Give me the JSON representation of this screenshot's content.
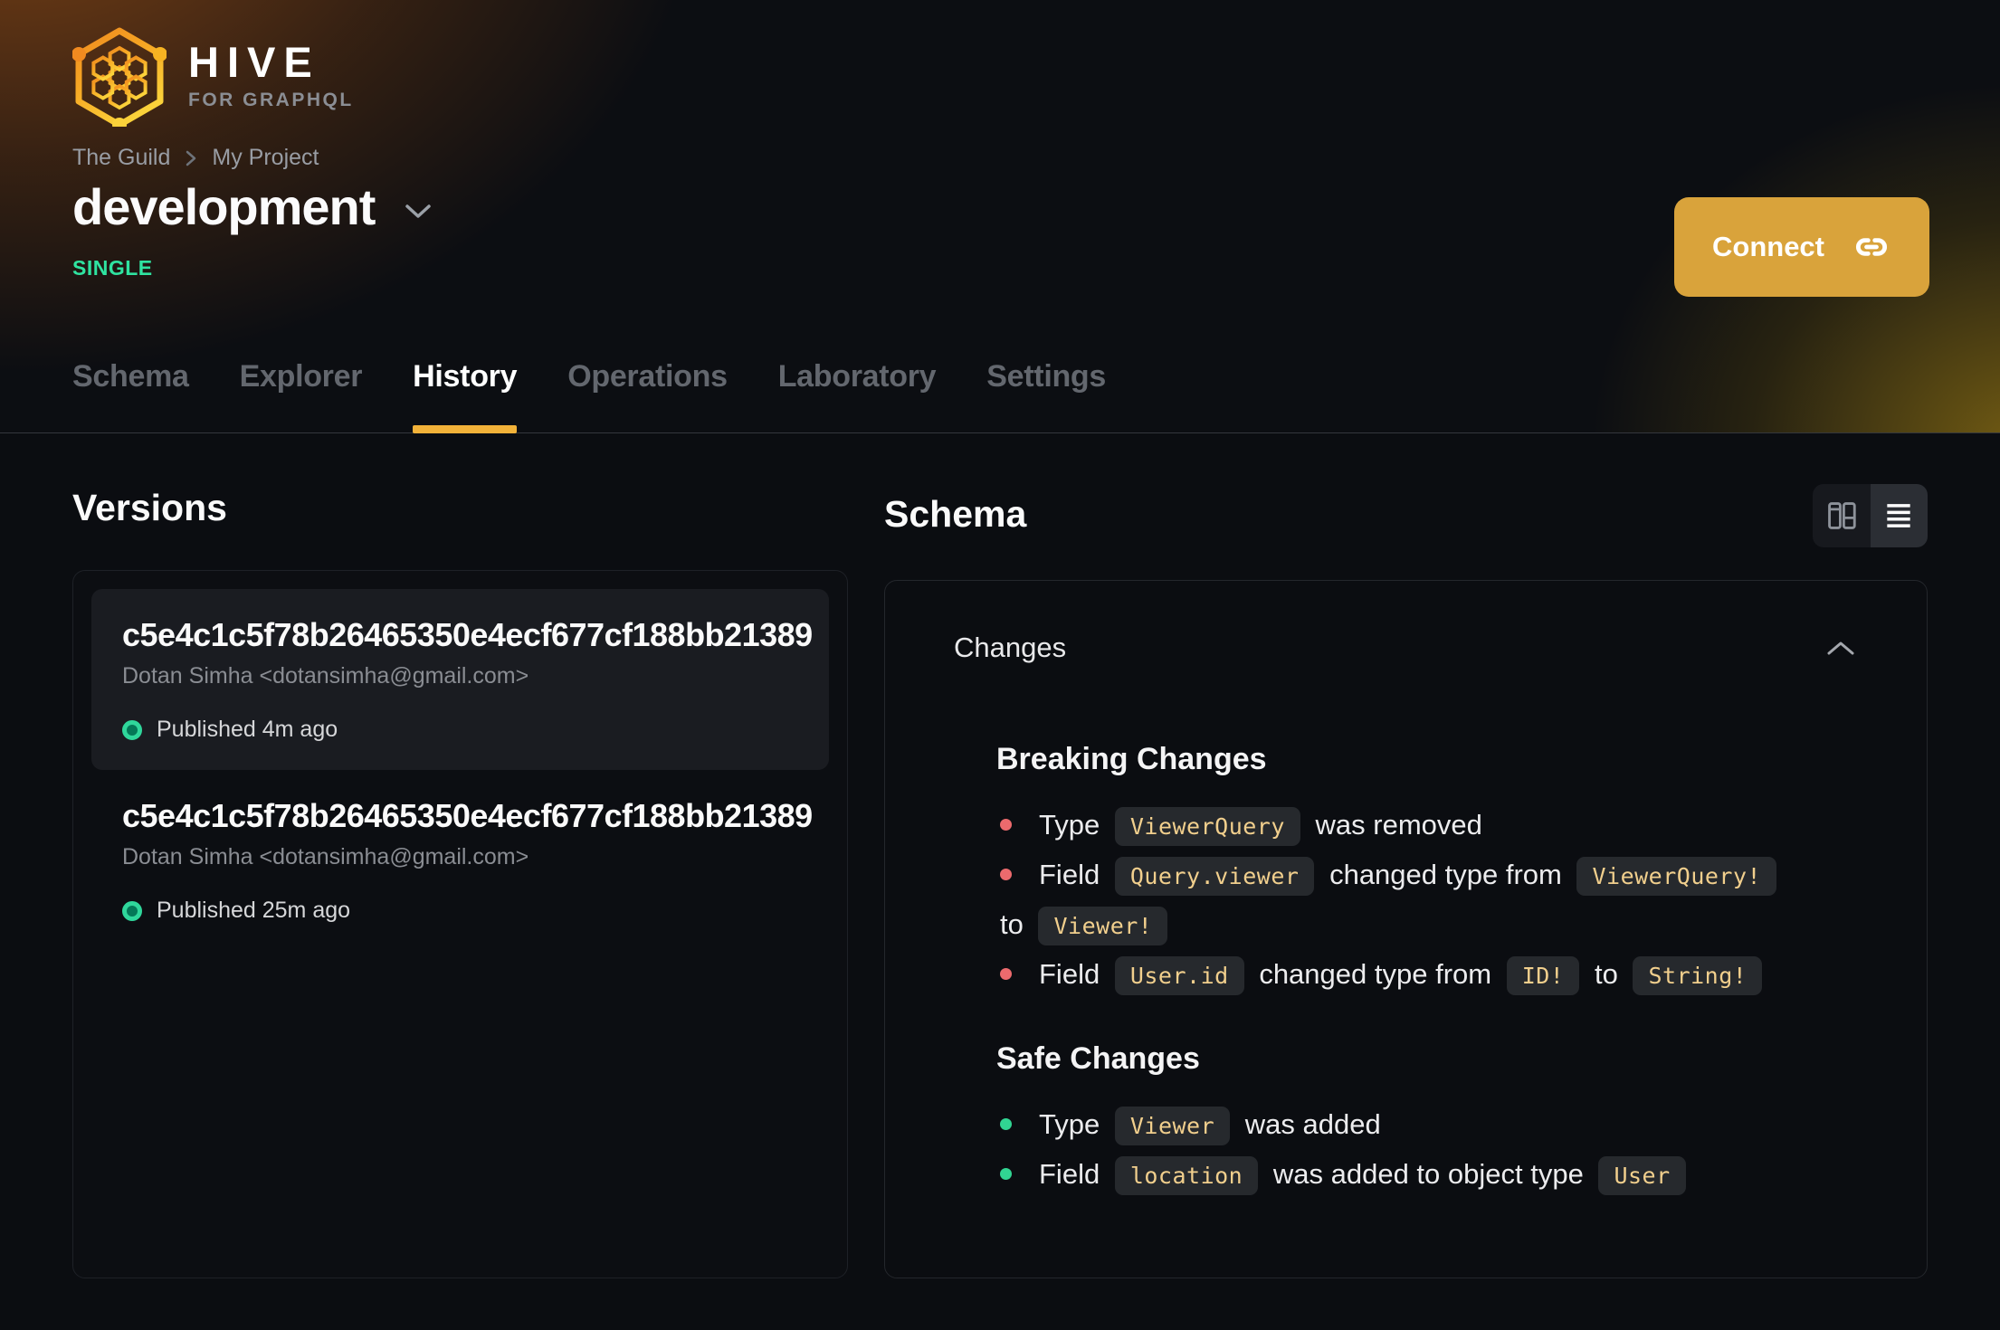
{
  "colors": {
    "accent": "#f2b239",
    "connect": "#d9a33b",
    "badge": "#2fe3a0",
    "chip": "#f1cf8d",
    "breaking": "#ec6a6d",
    "safe": "#31d492"
  },
  "brand": {
    "title": "HIVE",
    "subtitle": "FOR GRAPHQL"
  },
  "breadcrumb": [
    "The Guild",
    "My Project"
  ],
  "project": {
    "name": "development",
    "badge": "SINGLE"
  },
  "connect_label": "Connect",
  "tabs": [
    {
      "label": "Schema",
      "active": false
    },
    {
      "label": "Explorer",
      "active": false
    },
    {
      "label": "History",
      "active": true
    },
    {
      "label": "Operations",
      "active": false
    },
    {
      "label": "Laboratory",
      "active": false
    },
    {
      "label": "Settings",
      "active": false
    }
  ],
  "versions": {
    "heading": "Versions",
    "items": [
      {
        "hash": "c5e4c1c5f78b26465350e4ecf677cf188bb21389",
        "author": "Dotan Simha <dotansimha@gmail.com>",
        "status": "Published 4m ago"
      },
      {
        "hash": "c5e4c1c5f78b26465350e4ecf677cf188bb21389",
        "author": "Dotan Simha <dotansimha@gmail.com>",
        "status": "Published 25m ago"
      }
    ]
  },
  "schema_view": {
    "heading": "Schema",
    "panel_title": "Changes",
    "sections": [
      {
        "title": "Breaking Changes",
        "bullet_color": "#ec6a6d",
        "items": [
          [
            [
              "text",
              "Type"
            ],
            [
              "code",
              "ViewerQuery"
            ],
            [
              "text",
              "was removed"
            ]
          ],
          [
            [
              "text",
              "Field"
            ],
            [
              "code",
              "Query.viewer"
            ],
            [
              "text",
              "changed type from"
            ],
            [
              "code",
              "ViewerQuery!"
            ],
            [
              "br",
              ""
            ],
            [
              "text",
              "to"
            ],
            [
              "code",
              "Viewer!"
            ]
          ],
          [
            [
              "text",
              "Field"
            ],
            [
              "code",
              "User.id"
            ],
            [
              "text",
              "changed type from"
            ],
            [
              "code",
              "ID!"
            ],
            [
              "text",
              "to"
            ],
            [
              "code",
              "String!"
            ]
          ]
        ]
      },
      {
        "title": "Safe Changes",
        "bullet_color": "#31d492",
        "items": [
          [
            [
              "text",
              "Type"
            ],
            [
              "code",
              "Viewer"
            ],
            [
              "text",
              "was added"
            ]
          ],
          [
            [
              "text",
              "Field"
            ],
            [
              "code",
              "location"
            ],
            [
              "text",
              "was added to object type"
            ],
            [
              "code",
              "User"
            ]
          ]
        ]
      }
    ]
  }
}
